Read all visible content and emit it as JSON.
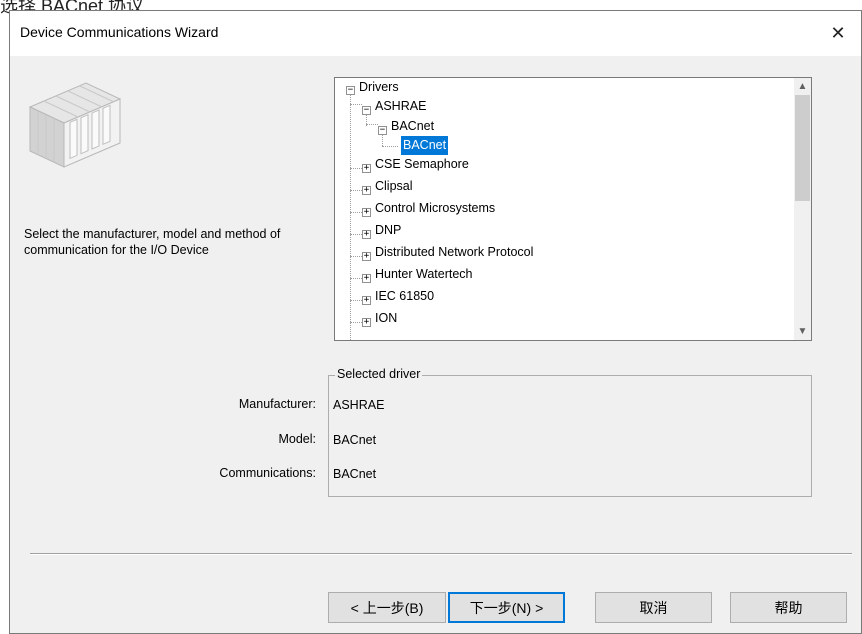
{
  "caption": "选择 BACnet 协议",
  "window": {
    "title": "Device Communications Wizard",
    "close_glyph": "✕"
  },
  "description": "Select the manufacturer, model and method of communication for the I/O Device",
  "tree": {
    "items": [
      {
        "label": "Drivers",
        "expander": "−"
      },
      {
        "label": "ASHRAE",
        "expander": "−"
      },
      {
        "label": "BACnet",
        "expander": "−"
      },
      {
        "label": "BACnet",
        "selected": true
      },
      {
        "label": "CSE Semaphore",
        "expander": "+"
      },
      {
        "label": "Clipsal",
        "expander": "+"
      },
      {
        "label": "Control Microsystems",
        "expander": "+"
      },
      {
        "label": "DNP",
        "expander": "+"
      },
      {
        "label": "Distributed Network Protocol",
        "expander": "+"
      },
      {
        "label": "Hunter Watertech",
        "expander": "+"
      },
      {
        "label": "IEC 61850",
        "expander": "+"
      },
      {
        "label": "ION",
        "expander": "+"
      }
    ],
    "scroll_up": "▲",
    "scroll_down": "▼"
  },
  "selected_driver": {
    "legend": "Selected driver",
    "manufacturer_label": "Manufacturer:",
    "manufacturer_value": "ASHRAE",
    "model_label": "Model:",
    "model_value": "BACnet",
    "communications_label": "Communications:",
    "communications_value": "BACnet"
  },
  "buttons": {
    "back": "< 上一步(B)",
    "next": "下一步(N) >",
    "cancel": "取消",
    "help": "帮助"
  },
  "colors": {
    "selection": "#0078d7",
    "dialog_bg": "#f0f0f0"
  },
  "icons": {
    "device": "io-device-icon"
  }
}
